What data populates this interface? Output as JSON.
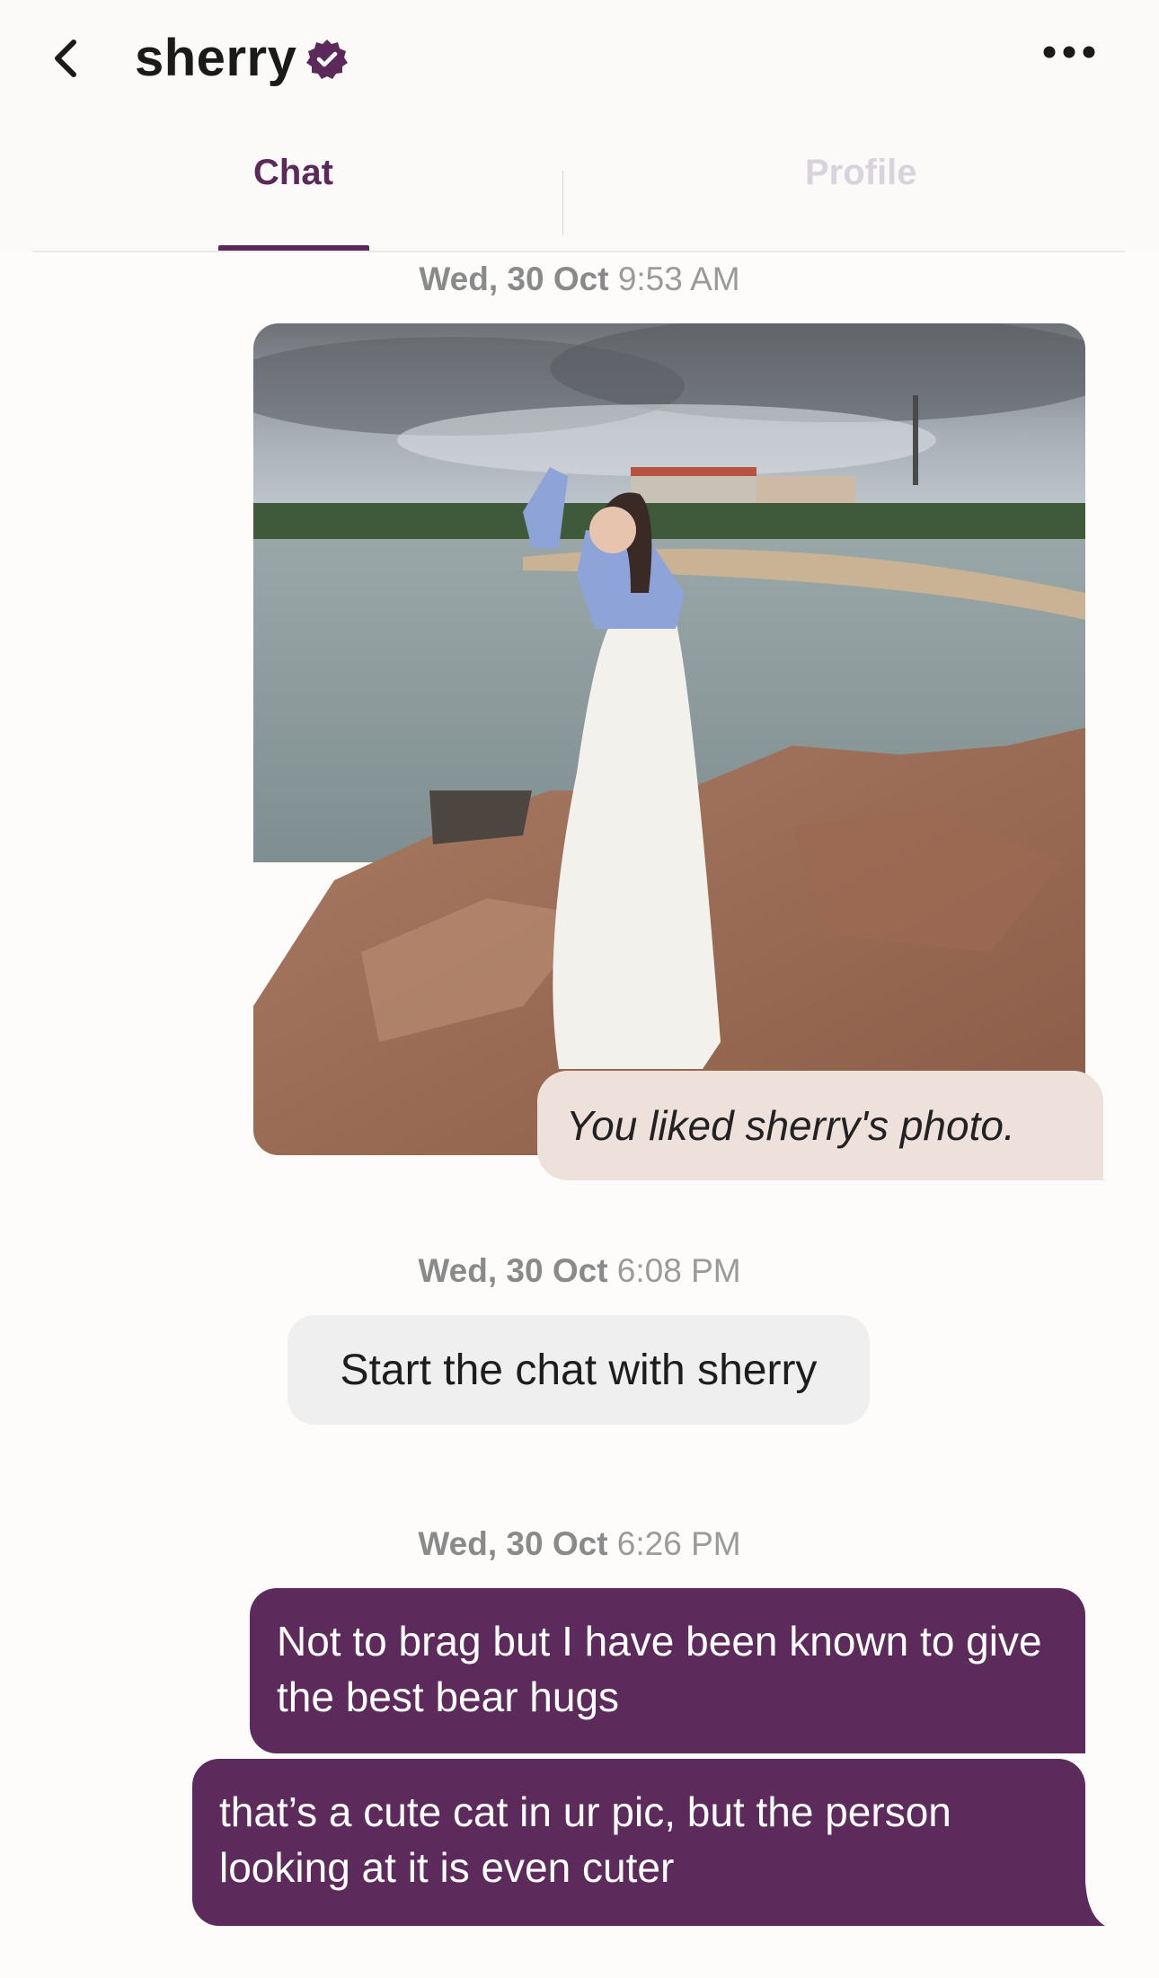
{
  "header": {
    "title": "sherry",
    "back_icon": "chevron-left-icon",
    "verified_icon": "verified-badge-icon",
    "more_icon": "more-horizontal-icon"
  },
  "tabs": [
    {
      "label": "Chat",
      "active": true
    },
    {
      "label": "Profile",
      "active": false
    }
  ],
  "messages": {
    "ts1": {
      "day": "Wed, 30 Oct",
      "time": "9:53 AM"
    },
    "liked_text": "You liked sherry's photo.",
    "ts2": {
      "day": "Wed, 30 Oct",
      "time": "6:08 PM"
    },
    "start_chat": "Start the chat with sherry",
    "ts3": {
      "day": "Wed, 30 Oct",
      "time": "6:26 PM"
    },
    "sent": [
      "Not to brag but I have been known to give the best bear hugs",
      "that’s a cute cat in ur pic, but the person looking at it is even cuter"
    ]
  },
  "colors": {
    "accent": "#5b2a5a",
    "sent_bubble": "#5d2a5c",
    "liked_bubble": "#eee1dc",
    "start_chip": "#efefef"
  }
}
